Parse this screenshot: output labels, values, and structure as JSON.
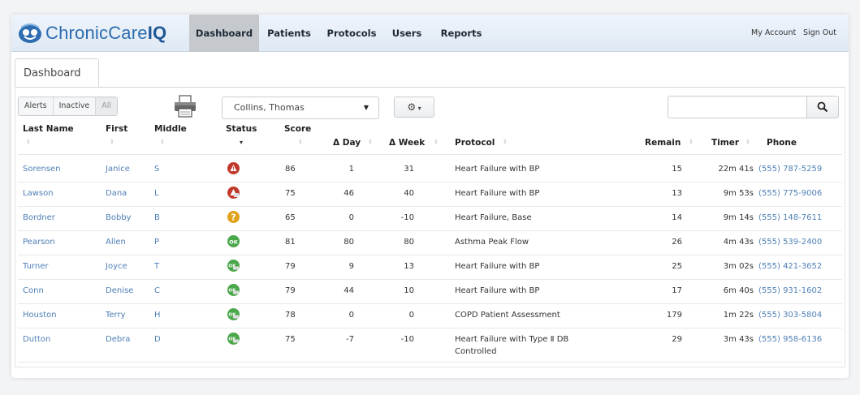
{
  "app": {
    "brand_prefix": "ChronicCare",
    "brand_suffix": "IQ"
  },
  "nav": {
    "items": [
      {
        "label": "Dashboard",
        "active": true
      },
      {
        "label": "Patients",
        "active": false
      },
      {
        "label": "Protocols",
        "active": false
      },
      {
        "label": "Users",
        "active": false
      },
      {
        "label": "Reports",
        "active": false
      }
    ],
    "my_account": "My Account",
    "sign_out": "Sign Out"
  },
  "page": {
    "tab": "Dashboard"
  },
  "filters": {
    "alerts": "Alerts",
    "inactive": "Inactive",
    "all": "All"
  },
  "toolbar": {
    "patient_select_value": "Collins, Thomas",
    "search_placeholder": "",
    "print_icon": "printer-icon",
    "gear_icon": "gear-icon",
    "search_icon": "search-icon"
  },
  "table": {
    "headers": {
      "last_name": "Last Name",
      "first": "First",
      "middle": "Middle",
      "status": "Status",
      "score": "Score",
      "day": "Δ Day",
      "week": "Δ Week",
      "protocol": "Protocol",
      "remain": "Remain",
      "timer": "Timer",
      "phone": "Phone"
    },
    "rows": [
      {
        "last": "Sorensen",
        "first": "Janice",
        "middle": "S",
        "status": "alert",
        "score": "86",
        "day": "1",
        "week": "31",
        "protocol": "Heart Failure with BP",
        "protocol2": "",
        "remain": "15",
        "timer": "22m 41s",
        "phone": "(555) 787-5259"
      },
      {
        "last": "Lawson",
        "first": "Dana",
        "middle": "L",
        "status": "alert-partial",
        "score": "75",
        "day": "46",
        "week": "40",
        "protocol": "Heart Failure with BP",
        "protocol2": "",
        "remain": "13",
        "timer": "9m 53s",
        "phone": "(555) 775-9006"
      },
      {
        "last": "Bordner",
        "first": "Bobby",
        "middle": "B",
        "status": "question",
        "score": "65",
        "day": "0",
        "week": "-10",
        "protocol": "Heart Failure, Base",
        "protocol2": "",
        "remain": "14",
        "timer": "9m 14s",
        "phone": "(555) 148-7611"
      },
      {
        "last": "Pearson",
        "first": "Allen",
        "middle": "P",
        "status": "ok",
        "score": "81",
        "day": "80",
        "week": "80",
        "protocol": "Asthma Peak Flow",
        "protocol2": "",
        "remain": "26",
        "timer": "4m 43s",
        "phone": "(555) 539-2400"
      },
      {
        "last": "Turner",
        "first": "Joyce",
        "middle": "T",
        "status": "ok-partial",
        "score": "79",
        "day": "9",
        "week": "13",
        "protocol": "Heart Failure with BP",
        "protocol2": "",
        "remain": "25",
        "timer": "3m 02s",
        "phone": "(555) 421-3652"
      },
      {
        "last": "Conn",
        "first": "Denise",
        "middle": "C",
        "status": "ok-partial",
        "score": "79",
        "day": "44",
        "week": "10",
        "protocol": "Heart Failure with BP",
        "protocol2": "",
        "remain": "17",
        "timer": "6m 40s",
        "phone": "(555) 931-1602"
      },
      {
        "last": "Houston",
        "first": "Terry",
        "middle": "H",
        "status": "ok-partial",
        "score": "78",
        "day": "0",
        "week": "0",
        "protocol": "COPD Patient Assessment",
        "protocol2": "",
        "remain": "179",
        "timer": "1m 22s",
        "phone": "(555) 303-5804"
      },
      {
        "last": "Dutton",
        "first": "Debra",
        "middle": "D",
        "status": "ok-partial",
        "score": "75",
        "day": "-7",
        "week": "-10",
        "protocol": "Heart Failure with Type Ⅱ DB",
        "protocol2": "Controlled",
        "remain": "29",
        "timer": "3m 43s",
        "phone": "(555) 958-6136"
      }
    ]
  },
  "colors": {
    "alert": "#c0392b",
    "question": "#e0a21b",
    "ok": "#4aa84a",
    "link": "#4f7fb6"
  }
}
